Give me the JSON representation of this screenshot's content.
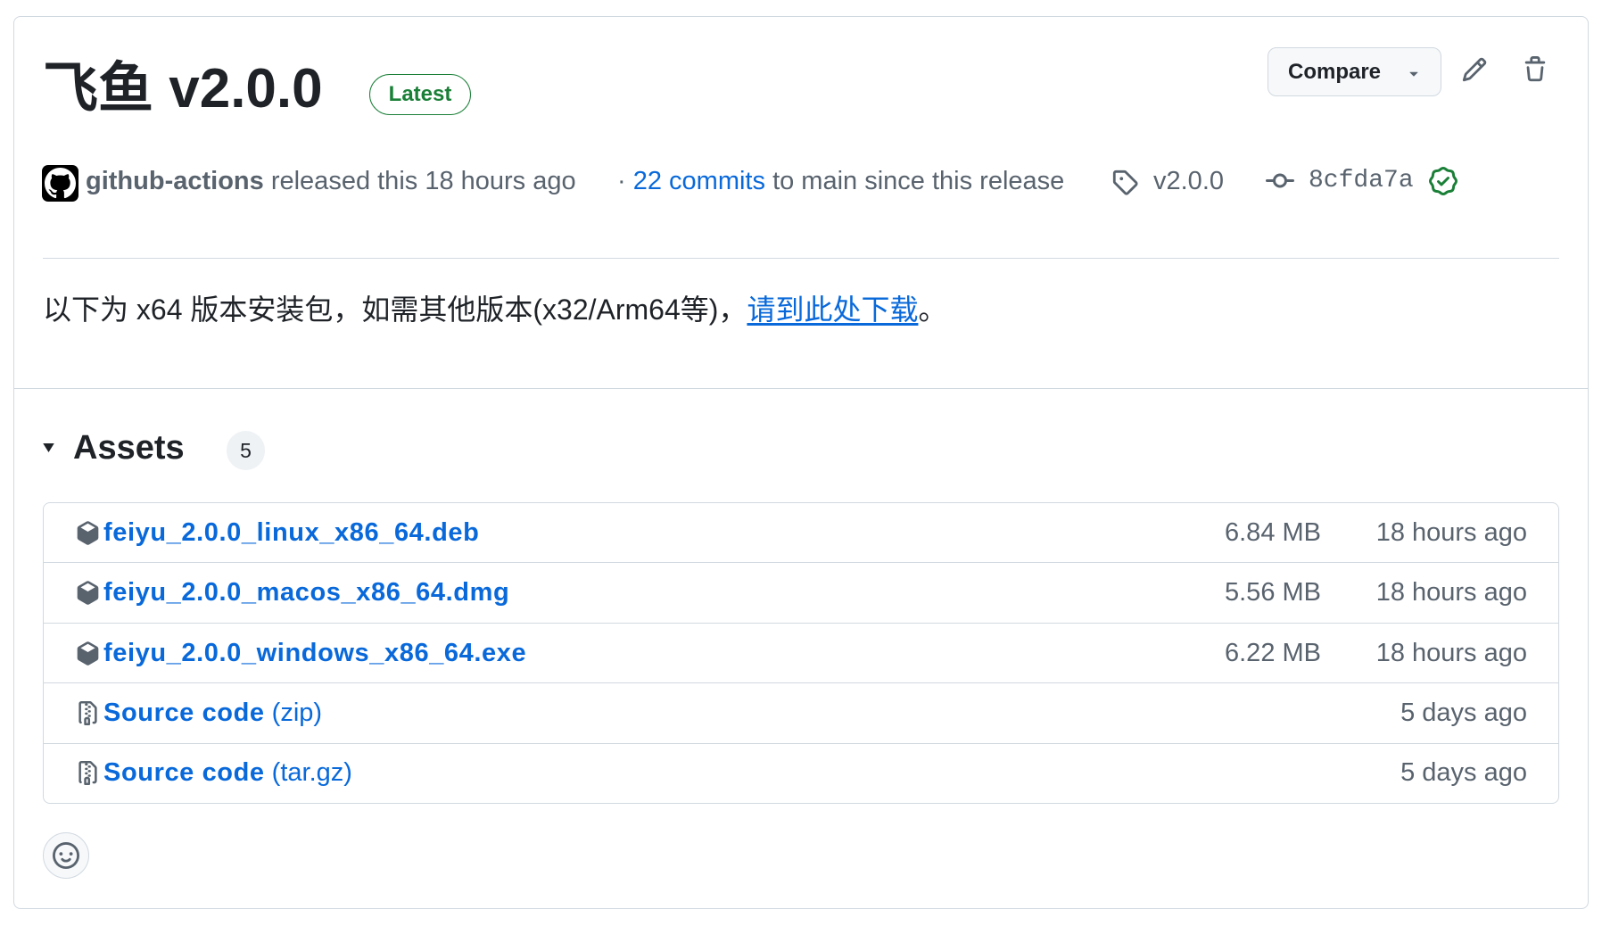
{
  "release": {
    "title": "飞鱼 v2.0.0",
    "badge": "Latest"
  },
  "actions": {
    "compare_label": "Compare",
    "compare_icon": "triangle-down-icon",
    "edit_icon": "pencil-icon",
    "delete_icon": "trash-icon"
  },
  "meta": {
    "avatar_icon": "github-mark-icon",
    "author": "github-actions",
    "released": "released this 18 hours ago",
    "separator": "·",
    "commits_link": "22 commits",
    "commits_suffix": "to main since this release",
    "tag_icon": "tag-icon",
    "tag": "v2.0.0",
    "commit_icon": "git-commit-icon",
    "commit_sha": "8cfda7a",
    "verified_icon": "verified-check-icon"
  },
  "body": {
    "text": "以下为 x64 版本安装包，如需其他版本(x32/Arm64等)，",
    "link": "请到此处下载",
    "suffix": "。"
  },
  "assets": {
    "heading": "Assets",
    "count": "5",
    "items": [
      {
        "icon": "package-icon",
        "name": "feiyu_2.0.0_linux_x86_64.deb",
        "suffix": "",
        "size": "6.84 MB",
        "time": "18 hours ago"
      },
      {
        "icon": "package-icon",
        "name": "feiyu_2.0.0_macos_x86_64.dmg",
        "suffix": "",
        "size": "5.56 MB",
        "time": "18 hours ago"
      },
      {
        "icon": "package-icon",
        "name": "feiyu_2.0.0_windows_x86_64.exe",
        "suffix": "",
        "size": "6.22 MB",
        "time": "18 hours ago"
      },
      {
        "icon": "file-zip-icon",
        "name": "Source code",
        "suffix": "(zip)",
        "size": "",
        "time": "5 days ago"
      },
      {
        "icon": "file-zip-icon",
        "name": "Source code",
        "suffix": "(tar.gz)",
        "size": "",
        "time": "5 days ago"
      }
    ]
  },
  "reactions": {
    "icon": "smiley-icon"
  },
  "colors": {
    "text": "#1f2328",
    "muted": "#59636e",
    "accent": "#0969da",
    "success": "#1a7f37",
    "border": "#d1d9e0",
    "button_bg": "#f6f8fa"
  }
}
